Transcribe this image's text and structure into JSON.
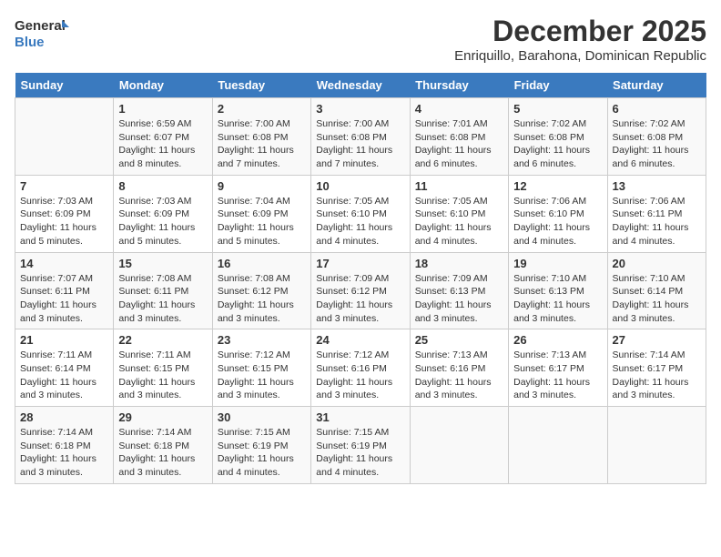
{
  "logo": {
    "general": "General",
    "blue": "Blue"
  },
  "title": {
    "main": "December 2025",
    "subtitle": "Enriquillo, Barahona, Dominican Republic"
  },
  "headers": [
    "Sunday",
    "Monday",
    "Tuesday",
    "Wednesday",
    "Thursday",
    "Friday",
    "Saturday"
  ],
  "weeks": [
    [
      {
        "day": "",
        "sunrise": "",
        "sunset": "",
        "daylight": ""
      },
      {
        "day": "1",
        "sunrise": "Sunrise: 6:59 AM",
        "sunset": "Sunset: 6:07 PM",
        "daylight": "Daylight: 11 hours and 8 minutes."
      },
      {
        "day": "2",
        "sunrise": "Sunrise: 7:00 AM",
        "sunset": "Sunset: 6:08 PM",
        "daylight": "Daylight: 11 hours and 7 minutes."
      },
      {
        "day": "3",
        "sunrise": "Sunrise: 7:00 AM",
        "sunset": "Sunset: 6:08 PM",
        "daylight": "Daylight: 11 hours and 7 minutes."
      },
      {
        "day": "4",
        "sunrise": "Sunrise: 7:01 AM",
        "sunset": "Sunset: 6:08 PM",
        "daylight": "Daylight: 11 hours and 6 minutes."
      },
      {
        "day": "5",
        "sunrise": "Sunrise: 7:02 AM",
        "sunset": "Sunset: 6:08 PM",
        "daylight": "Daylight: 11 hours and 6 minutes."
      },
      {
        "day": "6",
        "sunrise": "Sunrise: 7:02 AM",
        "sunset": "Sunset: 6:08 PM",
        "daylight": "Daylight: 11 hours and 6 minutes."
      }
    ],
    [
      {
        "day": "7",
        "sunrise": "Sunrise: 7:03 AM",
        "sunset": "Sunset: 6:09 PM",
        "daylight": "Daylight: 11 hours and 5 minutes."
      },
      {
        "day": "8",
        "sunrise": "Sunrise: 7:03 AM",
        "sunset": "Sunset: 6:09 PM",
        "daylight": "Daylight: 11 hours and 5 minutes."
      },
      {
        "day": "9",
        "sunrise": "Sunrise: 7:04 AM",
        "sunset": "Sunset: 6:09 PM",
        "daylight": "Daylight: 11 hours and 5 minutes."
      },
      {
        "day": "10",
        "sunrise": "Sunrise: 7:05 AM",
        "sunset": "Sunset: 6:10 PM",
        "daylight": "Daylight: 11 hours and 4 minutes."
      },
      {
        "day": "11",
        "sunrise": "Sunrise: 7:05 AM",
        "sunset": "Sunset: 6:10 PM",
        "daylight": "Daylight: 11 hours and 4 minutes."
      },
      {
        "day": "12",
        "sunrise": "Sunrise: 7:06 AM",
        "sunset": "Sunset: 6:10 PM",
        "daylight": "Daylight: 11 hours and 4 minutes."
      },
      {
        "day": "13",
        "sunrise": "Sunrise: 7:06 AM",
        "sunset": "Sunset: 6:11 PM",
        "daylight": "Daylight: 11 hours and 4 minutes."
      }
    ],
    [
      {
        "day": "14",
        "sunrise": "Sunrise: 7:07 AM",
        "sunset": "Sunset: 6:11 PM",
        "daylight": "Daylight: 11 hours and 3 minutes."
      },
      {
        "day": "15",
        "sunrise": "Sunrise: 7:08 AM",
        "sunset": "Sunset: 6:11 PM",
        "daylight": "Daylight: 11 hours and 3 minutes."
      },
      {
        "day": "16",
        "sunrise": "Sunrise: 7:08 AM",
        "sunset": "Sunset: 6:12 PM",
        "daylight": "Daylight: 11 hours and 3 minutes."
      },
      {
        "day": "17",
        "sunrise": "Sunrise: 7:09 AM",
        "sunset": "Sunset: 6:12 PM",
        "daylight": "Daylight: 11 hours and 3 minutes."
      },
      {
        "day": "18",
        "sunrise": "Sunrise: 7:09 AM",
        "sunset": "Sunset: 6:13 PM",
        "daylight": "Daylight: 11 hours and 3 minutes."
      },
      {
        "day": "19",
        "sunrise": "Sunrise: 7:10 AM",
        "sunset": "Sunset: 6:13 PM",
        "daylight": "Daylight: 11 hours and 3 minutes."
      },
      {
        "day": "20",
        "sunrise": "Sunrise: 7:10 AM",
        "sunset": "Sunset: 6:14 PM",
        "daylight": "Daylight: 11 hours and 3 minutes."
      }
    ],
    [
      {
        "day": "21",
        "sunrise": "Sunrise: 7:11 AM",
        "sunset": "Sunset: 6:14 PM",
        "daylight": "Daylight: 11 hours and 3 minutes."
      },
      {
        "day": "22",
        "sunrise": "Sunrise: 7:11 AM",
        "sunset": "Sunset: 6:15 PM",
        "daylight": "Daylight: 11 hours and 3 minutes."
      },
      {
        "day": "23",
        "sunrise": "Sunrise: 7:12 AM",
        "sunset": "Sunset: 6:15 PM",
        "daylight": "Daylight: 11 hours and 3 minutes."
      },
      {
        "day": "24",
        "sunrise": "Sunrise: 7:12 AM",
        "sunset": "Sunset: 6:16 PM",
        "daylight": "Daylight: 11 hours and 3 minutes."
      },
      {
        "day": "25",
        "sunrise": "Sunrise: 7:13 AM",
        "sunset": "Sunset: 6:16 PM",
        "daylight": "Daylight: 11 hours and 3 minutes."
      },
      {
        "day": "26",
        "sunrise": "Sunrise: 7:13 AM",
        "sunset": "Sunset: 6:17 PM",
        "daylight": "Daylight: 11 hours and 3 minutes."
      },
      {
        "day": "27",
        "sunrise": "Sunrise: 7:14 AM",
        "sunset": "Sunset: 6:17 PM",
        "daylight": "Daylight: 11 hours and 3 minutes."
      }
    ],
    [
      {
        "day": "28",
        "sunrise": "Sunrise: 7:14 AM",
        "sunset": "Sunset: 6:18 PM",
        "daylight": "Daylight: 11 hours and 3 minutes."
      },
      {
        "day": "29",
        "sunrise": "Sunrise: 7:14 AM",
        "sunset": "Sunset: 6:18 PM",
        "daylight": "Daylight: 11 hours and 3 minutes."
      },
      {
        "day": "30",
        "sunrise": "Sunrise: 7:15 AM",
        "sunset": "Sunset: 6:19 PM",
        "daylight": "Daylight: 11 hours and 4 minutes."
      },
      {
        "day": "31",
        "sunrise": "Sunrise: 7:15 AM",
        "sunset": "Sunset: 6:19 PM",
        "daylight": "Daylight: 11 hours and 4 minutes."
      },
      {
        "day": "",
        "sunrise": "",
        "sunset": "",
        "daylight": ""
      },
      {
        "day": "",
        "sunrise": "",
        "sunset": "",
        "daylight": ""
      },
      {
        "day": "",
        "sunrise": "",
        "sunset": "",
        "daylight": ""
      }
    ]
  ]
}
